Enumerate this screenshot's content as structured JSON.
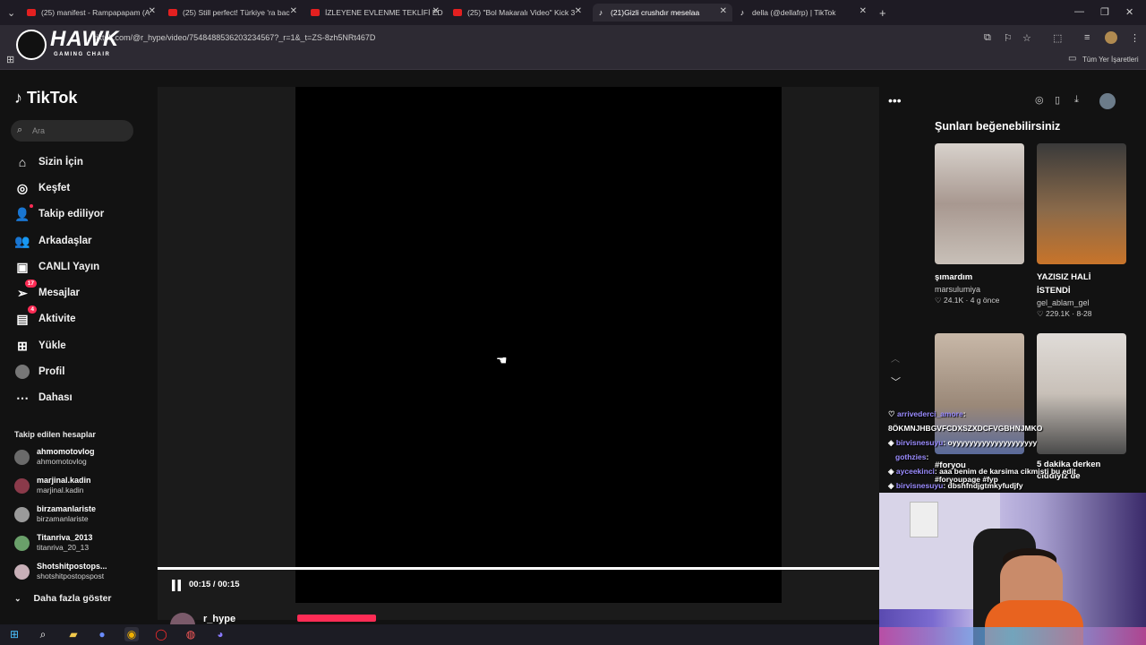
{
  "browser": {
    "tabs": [
      {
        "title": "(25) manifest - Rampapapam (A",
        "icon": "youtube-icon",
        "active": false
      },
      {
        "title": "(25) Still perfect! Türkiye 'ra bac",
        "icon": "youtube-icon",
        "active": false
      },
      {
        "title": "İZLEYENE EVLENME TEKLİFİ ED",
        "icon": "youtube-icon",
        "active": false
      },
      {
        "title": "(25) \"Bol Makaralı Video\" Kick 3",
        "icon": "youtube-icon",
        "active": false
      },
      {
        "title": "(21)Gizli crushdır meselaa",
        "icon": "tiktok-icon",
        "active": true
      },
      {
        "title": "della (@dellafrp) | TikTok",
        "icon": "tiktok-icon",
        "active": false
      }
    ],
    "url": "tiktok.com/@r_hype/video/7548488536203234567?_r=1&_t=ZS-8zh5NRt467D",
    "bookmarks_label": "Tüm Yer İşaretleri"
  },
  "overlay_brand": {
    "name": "HAWK",
    "tagline": "GAMING CHAIR"
  },
  "tiktok": {
    "logo": "TikTok",
    "search_placeholder": "Ara",
    "nav": [
      {
        "label": "Sizin İçin",
        "icon": "home-icon"
      },
      {
        "label": "Keşfet",
        "icon": "compass-icon"
      },
      {
        "label": "Takip ediliyor",
        "icon": "following-icon"
      },
      {
        "label": "Arkadaşlar",
        "icon": "friends-icon"
      },
      {
        "label": "CANLI Yayın",
        "icon": "live-icon"
      },
      {
        "label": "Mesajlar",
        "icon": "messages-icon",
        "badge": "17"
      },
      {
        "label": "Aktivite",
        "icon": "activity-icon",
        "badge": "4"
      },
      {
        "label": "Yükle",
        "icon": "upload-icon"
      },
      {
        "label": "Profil",
        "icon": "profile-icon"
      },
      {
        "label": "Dahası",
        "icon": "more-icon"
      }
    ],
    "following_title": "Takip edilen hesaplar",
    "following": [
      {
        "name": "ahmomotovlog",
        "user": "ahmomotovlog"
      },
      {
        "name": "marjinal.kadin",
        "user": "marjinal.kadin"
      },
      {
        "name": "birzamanlariste",
        "user": "birzamanlariste"
      },
      {
        "name": "Titanriva_2013",
        "user": "titanriva_20_13"
      },
      {
        "name": "Shotshitpostops...",
        "user": "shotshitpostopspost"
      }
    ],
    "show_more": "Daha fazla göster"
  },
  "player": {
    "time": "00:15 / 00:15",
    "progress": 1.0,
    "author": "r_hype"
  },
  "recommendations": {
    "title": "Şunları beğenebilirsiniz",
    "items": [
      {
        "title": "şımardım",
        "user": "marsulumiya",
        "stats": "24.1K · 4 g önce"
      },
      {
        "title": "YAZISIZ HALİ İSTENDİ",
        "user": "gel_ablam_gel",
        "stats": "229.1K · 8-28"
      },
      {
        "title": "#foryou",
        "user": "",
        "stats": ""
      },
      {
        "title": "5 dakika derken ciddiyiz de",
        "user": "",
        "stats": ""
      }
    ]
  },
  "chat": [
    {
      "user": "arrivederci_amore",
      "text": ":"
    },
    {
      "user": "",
      "text": "8ÖKMNJHBGVFCDXSZXDCFVGBHNJMKO"
    },
    {
      "user": "birvisnesuyu",
      "text": ": oyyyyyyyyyyyyyyyyyyyy"
    },
    {
      "user": "gothzies",
      "text": ":"
    },
    {
      "user": "ayceekinci",
      "text": ": aaa benim de karsima cikmisti bu edit"
    },
    {
      "user": "",
      "text": "#foryoupage #fyp"
    },
    {
      "user": "birvisnesuyu",
      "text": ": dbshfndjgtmkyfudjfy"
    }
  ],
  "colors": {
    "accent": "#fe2c55",
    "bg": "#121212",
    "chat_user": "#9b8cff"
  }
}
